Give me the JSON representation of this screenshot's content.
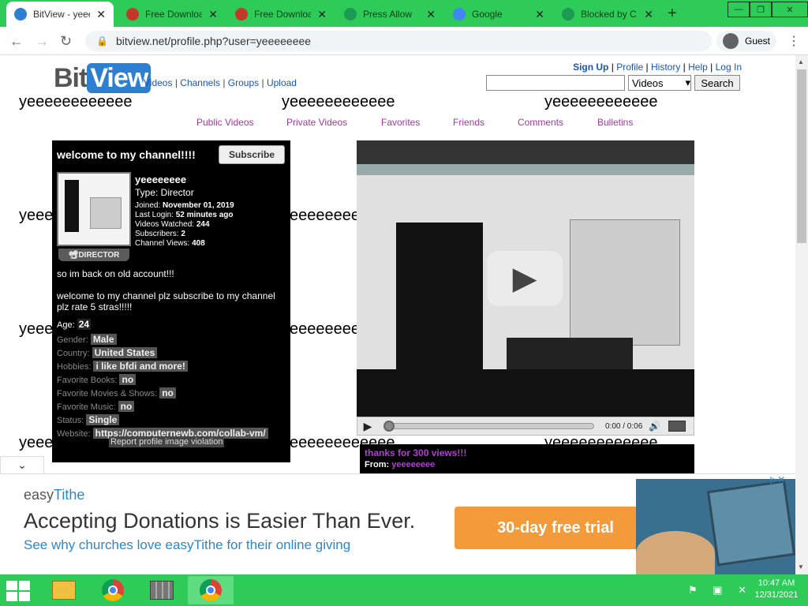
{
  "browser": {
    "tabs": [
      {
        "title": "BitView - yeee",
        "favicon_color": "#2f7fd1",
        "active": true
      },
      {
        "title": "Free Downloa",
        "favicon_color": "#c0392b",
        "active": false
      },
      {
        "title": "Free Downloa",
        "favicon_color": "#c0392b",
        "active": false
      },
      {
        "title": "Press Allow",
        "favicon_color": "#1f9a55",
        "active": false
      },
      {
        "title": "Google",
        "favicon_color": "#4285f4",
        "active": false
      },
      {
        "title": "Blocked by C",
        "favicon_color": "#1f9a55",
        "active": false
      }
    ],
    "close_glyph": "✕",
    "newtab_glyph": "+",
    "url": "bitview.net/profile.php?user=yeeeeeeee",
    "profile_label": "Guest",
    "window_buttons": {
      "minimize": "—",
      "maximize": "❐",
      "close": "✕"
    },
    "nav": {
      "back": "←",
      "forward": "→",
      "reload": "↻",
      "lock": "🔒",
      "menu": "⋮"
    }
  },
  "site": {
    "logo_bit": "Bit",
    "logo_view": "View",
    "nav": [
      "Videos",
      "Channels",
      "Groups",
      "Upload"
    ],
    "top_links": [
      "Sign Up",
      "Profile",
      "History",
      "Help",
      "Log In"
    ],
    "search_select": "Videos",
    "search_button": "Search",
    "section_nav": [
      "Public Videos",
      "Private Videos",
      "Favorites",
      "Friends",
      "Comments",
      "Bulletins"
    ],
    "background_text": "yeeeeeeeeeeee"
  },
  "channel": {
    "title": "welcome to my channel!!!!",
    "subscribe": "Subscribe",
    "badge": "DIRECTOR",
    "name": "yeeeeeeee",
    "type": "Type: Director",
    "stats": [
      {
        "label": "Joined:",
        "value": "November 01, 2019"
      },
      {
        "label": "Last Login:",
        "value": "52 minutes ago"
      },
      {
        "label": "Videos Watched:",
        "value": "244"
      },
      {
        "label": "Subscribers:",
        "value": "2"
      },
      {
        "label": "Channel Views:",
        "value": "408"
      }
    ],
    "description": [
      "so im back on old account!!!",
      "welcome to my channel plz subscribe to my channel plz rate 5 stras!!!!!"
    ],
    "age_label": "Age:",
    "age": "24",
    "fields": [
      {
        "label": "Gender:",
        "value": "Male"
      },
      {
        "label": "Country:",
        "value": "United States"
      },
      {
        "label": "Hobbies:",
        "value": "i like bfdi and more!"
      },
      {
        "label": "Favorite Books:",
        "value": "no"
      },
      {
        "label": "Favorite Movies & Shows:",
        "value": "no"
      },
      {
        "label": "Favorite Music:",
        "value": "no"
      },
      {
        "label": "Status:",
        "value": "Single"
      },
      {
        "label": "Website:",
        "value": "https://computernewb.com/collab-vm/"
      }
    ],
    "report": "Report profile image violation"
  },
  "player": {
    "time": "0:00 / 0:06",
    "progress": 0,
    "play_glyph": "▶",
    "volume_glyph": "🔊"
  },
  "comment": {
    "title": "thanks for 300 views!!!",
    "from_label": "From:",
    "from_user": "yeeeeeeee"
  },
  "ad": {
    "brand_easy": "easy",
    "brand_tithe": "Tithe",
    "headline": "Accepting Donations is Easier Than Ever.",
    "sub": "See why churches love easyTithe for their online giving",
    "cta": "30-day free trial",
    "choices_glyph": "▷✕",
    "collapse_glyph": "⌄"
  },
  "taskbar": {
    "tray": "⚑ ▣ ✕",
    "time": "10:47 AM",
    "date": "12/31/2021"
  }
}
